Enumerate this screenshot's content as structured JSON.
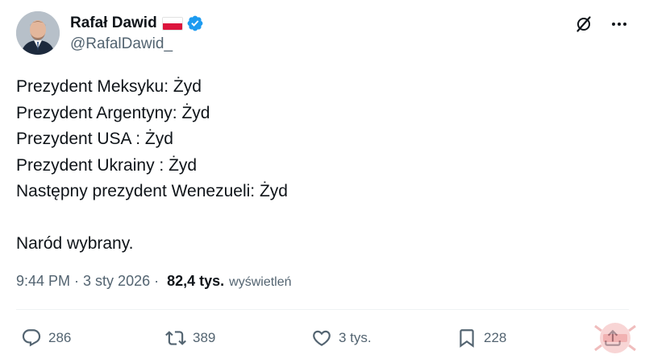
{
  "author": {
    "display_name": "Rafał Dawid",
    "handle": "@RafalDawid_",
    "flag": "poland-flag",
    "verified_icon": "verified-badge-icon",
    "verified_color": "#1d9bf0"
  },
  "tweet": {
    "lines": [
      "Prezydent Meksyku: Żyd",
      "Prezydent Argentyny: Żyd",
      "Prezydent USA : Żyd",
      "Prezydent Ukrainy : Żyd",
      "Następny prezydent Wenezueli: Żyd",
      "",
      "Naród wybrany."
    ]
  },
  "meta": {
    "time": "9:44 PM",
    "separator": "·",
    "date": "3 sty 2026",
    "views_count": "82,4 tys.",
    "views_label": "wyświetleń"
  },
  "actions": {
    "replies": "286",
    "reposts": "389",
    "likes": "3 tys.",
    "bookmarks": "228"
  },
  "colors": {
    "text": "#0f1419",
    "secondary": "#536471",
    "accent": "#1d9bf0"
  }
}
